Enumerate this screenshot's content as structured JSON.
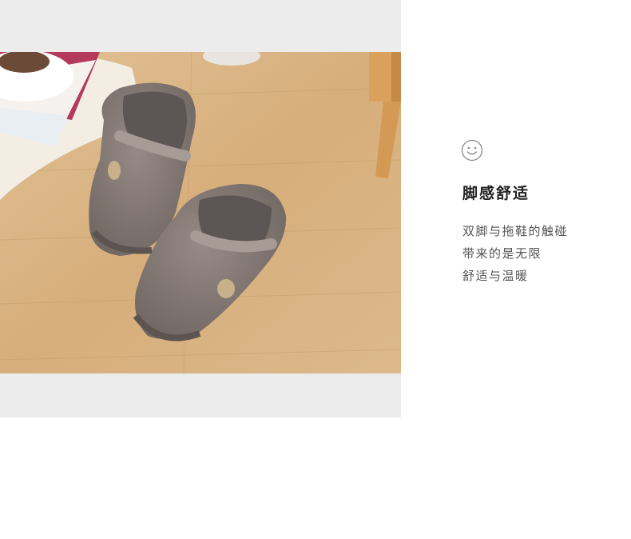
{
  "feature": {
    "icon": "smile-face-icon",
    "title": "脚感舒适",
    "lines": [
      "双脚与拖鞋的触碰",
      "带来的是无限",
      "舒适与温暖"
    ]
  },
  "colors": {
    "panel_bg": "#ececec",
    "floor": "#d9b483",
    "slipper": "#857a75",
    "title_text": "#222222",
    "body_text": "#555555",
    "icon": "#8a8a8a"
  }
}
